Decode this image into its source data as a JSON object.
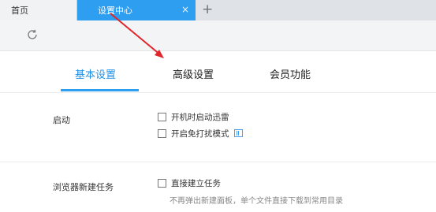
{
  "tabs": {
    "home_label": "首页",
    "settings_label": "设置中心",
    "close_glyph": "×",
    "new_tab_glyph": "+"
  },
  "toolbar": {
    "refresh_icon": "refresh-icon"
  },
  "settings_nav": {
    "basic": "基本设置",
    "advanced": "高级设置",
    "member": "会员功能",
    "active_color": "#1f8fe5"
  },
  "startup": {
    "label": "启动",
    "option_autostart": "开机时启动迅雷",
    "option_dnd": "开启免打扰模式"
  },
  "browser_task": {
    "label": "浏览器新建任务",
    "option_direct": "直接建立任务",
    "hint": "不再弹出新建面板，单个文件直接下载到常用目录"
  },
  "colors": {
    "accent": "#2d9ef0",
    "annotation_arrow": "#e0262b"
  }
}
